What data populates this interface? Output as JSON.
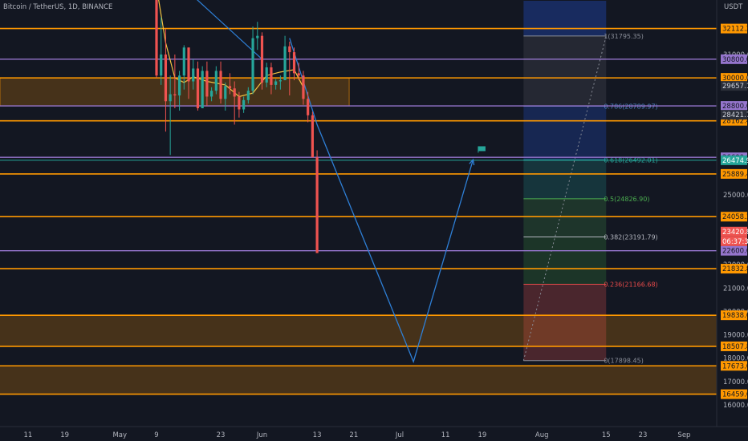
{
  "header": {
    "symbol_label": "Bitcoin / TetherUS, 1D, BINANCE",
    "currency_label": "USDT"
  },
  "chart_data": {
    "type": "candlestick",
    "title": "Bitcoin / TetherUS, 1D, BINANCE",
    "y_unit": "USDT",
    "ylim": [
      15700,
      33000
    ],
    "y_ticks": [
      {
        "value": 31000,
        "label": "31000.00"
      },
      {
        "value": 30000,
        "label": "30000.00"
      },
      {
        "value": 25000,
        "label": "25000.00"
      },
      {
        "value": 22000,
        "label": "22000.00"
      },
      {
        "value": 21000,
        "label": "21000.00"
      },
      {
        "value": 20000,
        "label": "20000.00"
      },
      {
        "value": 19000,
        "label": "19000.00"
      },
      {
        "value": 18000,
        "label": "18000.00"
      },
      {
        "value": 17000,
        "label": "17000.00"
      },
      {
        "value": 16000,
        "label": "16000.00"
      }
    ],
    "x_range": [
      "2022-04-07",
      "2022-09-11"
    ],
    "x_ticks": [
      {
        "date": "2022-04-11",
        "label": "11"
      },
      {
        "date": "2022-04-19",
        "label": "19"
      },
      {
        "date": "2022-05-01",
        "label": "May"
      },
      {
        "date": "2022-05-09",
        "label": "9"
      },
      {
        "date": "2022-05-23",
        "label": "23"
      },
      {
        "date": "2022-06-01",
        "label": "Jun"
      },
      {
        "date": "2022-06-13",
        "label": "13"
      },
      {
        "date": "2022-06-21",
        "label": "21"
      },
      {
        "date": "2022-07-01",
        "label": "Jul"
      },
      {
        "date": "2022-07-11",
        "label": "11"
      },
      {
        "date": "2022-07-19",
        "label": "19"
      },
      {
        "date": "2022-08-01",
        "label": "Aug"
      },
      {
        "date": "2022-08-15",
        "label": "15"
      },
      {
        "date": "2022-08-23",
        "label": "23"
      },
      {
        "date": "2022-09-01",
        "label": "Sep"
      }
    ],
    "candles": [
      {
        "date": "2022-05-09",
        "open": 34000,
        "high": 34500,
        "low": 30000,
        "close": 30100
      },
      {
        "date": "2022-05-10",
        "open": 30100,
        "high": 32600,
        "low": 29700,
        "close": 31000
      },
      {
        "date": "2022-05-11",
        "open": 31000,
        "high": 32100,
        "low": 27700,
        "close": 29000
      },
      {
        "date": "2022-05-12",
        "open": 29000,
        "high": 30100,
        "low": 26700,
        "close": 29300
      },
      {
        "date": "2022-05-13",
        "open": 29300,
        "high": 31000,
        "low": 28700,
        "close": 29250
      },
      {
        "date": "2022-05-14",
        "open": 29250,
        "high": 30300,
        "low": 28600,
        "close": 30100
      },
      {
        "date": "2022-05-15",
        "open": 30100,
        "high": 31400,
        "low": 29500,
        "close": 31300
      },
      {
        "date": "2022-05-16",
        "open": 31300,
        "high": 31300,
        "low": 29100,
        "close": 29850
      },
      {
        "date": "2022-05-17",
        "open": 29850,
        "high": 30800,
        "low": 29500,
        "close": 30400
      },
      {
        "date": "2022-05-18",
        "open": 30400,
        "high": 30700,
        "low": 28600,
        "close": 28700
      },
      {
        "date": "2022-05-19",
        "open": 28700,
        "high": 30500,
        "low": 28700,
        "close": 30300
      },
      {
        "date": "2022-05-20",
        "open": 30300,
        "high": 30700,
        "low": 28800,
        "close": 29200
      },
      {
        "date": "2022-05-21",
        "open": 29200,
        "high": 29600,
        "low": 29000,
        "close": 29450
      },
      {
        "date": "2022-05-22",
        "open": 29450,
        "high": 30500,
        "low": 29300,
        "close": 30300
      },
      {
        "date": "2022-05-23",
        "open": 30300,
        "high": 30700,
        "low": 28900,
        "close": 29100
      },
      {
        "date": "2022-05-24",
        "open": 29100,
        "high": 29800,
        "low": 28600,
        "close": 29650
      },
      {
        "date": "2022-05-25",
        "open": 29650,
        "high": 30200,
        "low": 29300,
        "close": 29550
      },
      {
        "date": "2022-05-26",
        "open": 29550,
        "high": 29850,
        "low": 28000,
        "close": 29200
      },
      {
        "date": "2022-05-27",
        "open": 29200,
        "high": 29400,
        "low": 28300,
        "close": 28650
      },
      {
        "date": "2022-05-28",
        "open": 28650,
        "high": 29200,
        "low": 28500,
        "close": 29050
      },
      {
        "date": "2022-05-29",
        "open": 29050,
        "high": 29600,
        "low": 28900,
        "close": 29450
      },
      {
        "date": "2022-05-30",
        "open": 29450,
        "high": 32200,
        "low": 29300,
        "close": 31700
      },
      {
        "date": "2022-05-31",
        "open": 31700,
        "high": 32400,
        "low": 31200,
        "close": 31800
      },
      {
        "date": "2022-06-01",
        "open": 31800,
        "high": 31950,
        "low": 29500,
        "close": 29800
      },
      {
        "date": "2022-06-02",
        "open": 29800,
        "high": 30650,
        "low": 29600,
        "close": 30450
      },
      {
        "date": "2022-06-03",
        "open": 30450,
        "high": 30650,
        "low": 29300,
        "close": 29700
      },
      {
        "date": "2022-06-04",
        "open": 29700,
        "high": 29950,
        "low": 29500,
        "close": 29850
      },
      {
        "date": "2022-06-05",
        "open": 29850,
        "high": 30100,
        "low": 29500,
        "close": 29900
      },
      {
        "date": "2022-06-06",
        "open": 29900,
        "high": 31800,
        "low": 29900,
        "close": 31350
      },
      {
        "date": "2022-06-07",
        "open": 31350,
        "high": 31550,
        "low": 29250,
        "close": 31100
      },
      {
        "date": "2022-06-08",
        "open": 31100,
        "high": 31300,
        "low": 29900,
        "close": 30200
      },
      {
        "date": "2022-06-09",
        "open": 30200,
        "high": 30650,
        "low": 29900,
        "close": 30100
      },
      {
        "date": "2022-06-10",
        "open": 30100,
        "high": 30300,
        "low": 28850,
        "close": 29100
      },
      {
        "date": "2022-06-11",
        "open": 29100,
        "high": 29400,
        "low": 28100,
        "close": 28400
      },
      {
        "date": "2022-06-12",
        "open": 28400,
        "high": 28550,
        "low": 26600,
        "close": 26600
      },
      {
        "date": "2022-06-13",
        "open": 26600,
        "high": 26900,
        "low": 22600,
        "close": 22500
      }
    ],
    "moving_average": [
      {
        "date": "2022-05-09",
        "value": 33900
      },
      {
        "date": "2022-05-11",
        "value": 31500
      },
      {
        "date": "2022-05-13",
        "value": 30000
      },
      {
        "date": "2022-05-15",
        "value": 29800
      },
      {
        "date": "2022-05-17",
        "value": 30050
      },
      {
        "date": "2022-05-20",
        "value": 29850
      },
      {
        "date": "2022-05-24",
        "value": 29700
      },
      {
        "date": "2022-05-27",
        "value": 29200
      },
      {
        "date": "2022-05-30",
        "value": 29350
      },
      {
        "date": "2022-06-02",
        "value": 30100
      },
      {
        "date": "2022-06-05",
        "value": 30250
      },
      {
        "date": "2022-06-08",
        "value": 30350
      },
      {
        "date": "2022-06-10",
        "value": 29600
      }
    ],
    "trend_line": [
      {
        "date": "2022-05-12",
        "value": 34400
      },
      {
        "date": "2022-06-01",
        "value": 30800
      }
    ],
    "projection_path": [
      {
        "date": "2022-06-07",
        "value": 31700
      },
      {
        "date": "2022-06-13",
        "value": 28000
      },
      {
        "date": "2022-07-04",
        "value": 17850
      },
      {
        "date": "2022-07-17",
        "value": 26500
      }
    ],
    "flag_marker": {
      "date": "2022-07-19",
      "value": 26900
    },
    "horizontal_levels": [
      {
        "value": 32112.28,
        "label": "32112.28",
        "kind": "orange"
      },
      {
        "value": 30800,
        "label": "30800.00",
        "kind": "purple"
      },
      {
        "value": 30000,
        "label": "30000.00",
        "kind": "orange"
      },
      {
        "value": 28800,
        "label": "28800.00",
        "kind": "purple"
      },
      {
        "value": 28162.48,
        "label": "28162.48",
        "kind": "orange"
      },
      {
        "value": 26600,
        "label": "26600.00",
        "kind": "purple"
      },
      {
        "value": 25889.43,
        "label": "25889.43",
        "kind": "orange"
      },
      {
        "value": 24058.35,
        "label": "24058.35",
        "kind": "orange"
      },
      {
        "value": 22600,
        "label": "22600.00",
        "kind": "purple"
      },
      {
        "value": 21832.86,
        "label": "21832.86",
        "kind": "orange"
      },
      {
        "value": 19838.68,
        "label": "19838.68",
        "kind": "orange"
      },
      {
        "value": 18507.87,
        "label": "18507.87",
        "kind": "orange"
      },
      {
        "value": 17673.05,
        "label": "17673.05",
        "kind": "orange"
      },
      {
        "value": 16459.64,
        "label": "16459.64",
        "kind": "orange"
      }
    ],
    "zones": [
      {
        "from": 28800,
        "to": 30000,
        "end_date": "2022-06-20"
      },
      {
        "from": 18507.87,
        "to": 19838.68
      },
      {
        "from": 16459.64,
        "to": 17673.05
      }
    ],
    "price_tags": [
      {
        "value": 29657.13,
        "label": "29657.13"
      },
      {
        "value": 28421.71,
        "label": "28421.71"
      },
      {
        "value": 26474.93,
        "label": "26474.93",
        "style": "teal"
      },
      {
        "value": 23420.84,
        "label": "23420.84",
        "style": "red"
      }
    ],
    "countdown": "06:37:31",
    "current_price_line": 26474.93,
    "fibonacci": {
      "start_date": "2022-07-28",
      "end_date": "2022-08-15",
      "levels": [
        {
          "value": 31795.35,
          "label": "1(31795.35)",
          "color": "#8a8e99"
        },
        {
          "value": 28789.97,
          "label": "0.786(28789.97)",
          "color": "#4f86c6"
        },
        {
          "value": 26492.01,
          "label": "0.618(26492.01)",
          "color": "#26a69a"
        },
        {
          "value": 24826.9,
          "label": "0.5(24826.90)",
          "color": "#4caf50"
        },
        {
          "value": 23191.79,
          "label": "0.382(23191.79)",
          "color": "#b2b5be"
        },
        {
          "value": 21166.68,
          "label": "0.236(21166.68)",
          "color": "#e64a4a"
        },
        {
          "value": 17898.45,
          "label": "0(17898.45)",
          "color": "#8a8e99"
        }
      ],
      "column_top": 33300
    },
    "colors": {
      "up": "#26a69a",
      "down": "#ef5350",
      "orange_level": "#ff9800",
      "purple_level": "#9575cd",
      "projection": "#2e7fd6",
      "background": "#131722"
    }
  }
}
